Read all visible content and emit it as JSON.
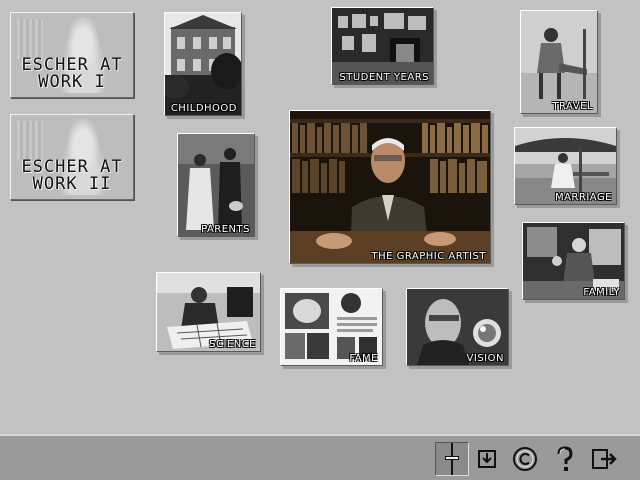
{
  "plaques": [
    {
      "title": "ESCHER AT WORK I"
    },
    {
      "title": "ESCHER AT WORK II"
    }
  ],
  "tiles": {
    "childhood": "CHILDHOOD",
    "student_years": "STUDENT YEARS",
    "travel": "TRAVEL",
    "parents": "PARENTS",
    "graphic_artist": "THE GRAPHIC ARTIST",
    "marriage": "MARRIAGE",
    "family": "FAMILY",
    "science": "SCIENCE",
    "fame": "FAME",
    "vision": "VISION"
  },
  "toolbar": {
    "icons": [
      "timeline-marker-icon",
      "download-icon",
      "copyright-icon",
      "help-icon",
      "exit-icon"
    ]
  }
}
